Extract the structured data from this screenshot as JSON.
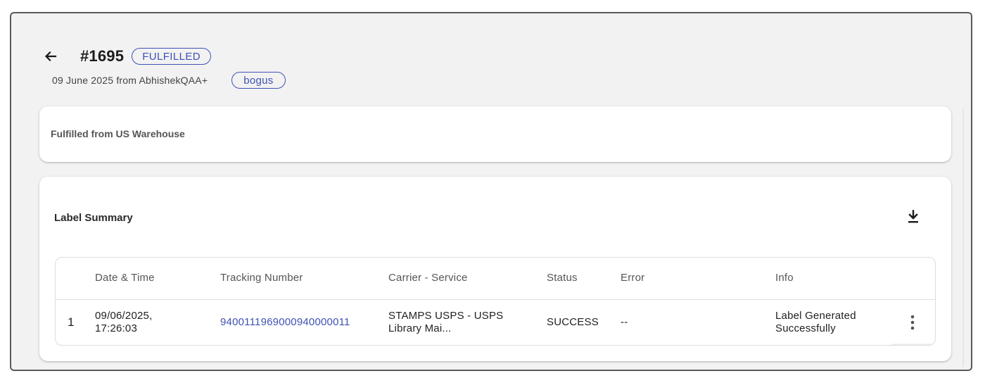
{
  "header": {
    "order_number": "#1695",
    "status_chip": "FULFILLED",
    "date_source": "09 June 2025 from AbhishekQAA+",
    "tag": "bogus"
  },
  "fulfillment": {
    "text": "Fulfilled from US Warehouse"
  },
  "label_summary": {
    "title": "Label Summary",
    "columns": [
      "",
      "Date & Time",
      "Tracking Number",
      "Carrier - Service",
      "Status",
      "Error",
      "Info"
    ],
    "rows": [
      {
        "index": "1",
        "date_time_line1": "09/06/2025,",
        "date_time_line2": "17:26:03",
        "tracking_number": "9400111969000940000011",
        "carrier_line1": "STAMPS USPS - USPS",
        "carrier_line2": "Library Mai...",
        "status": "SUCCESS",
        "error": "--",
        "info_line1": "Label Generated",
        "info_line2": "Successfully"
      }
    ]
  },
  "icons": {
    "back": "arrow-left-icon",
    "download": "download-icon",
    "more": "more-vertical-icon"
  },
  "colors": {
    "accent": "#3f51b5",
    "background": "#f2f2f2",
    "card": "#ffffff"
  }
}
